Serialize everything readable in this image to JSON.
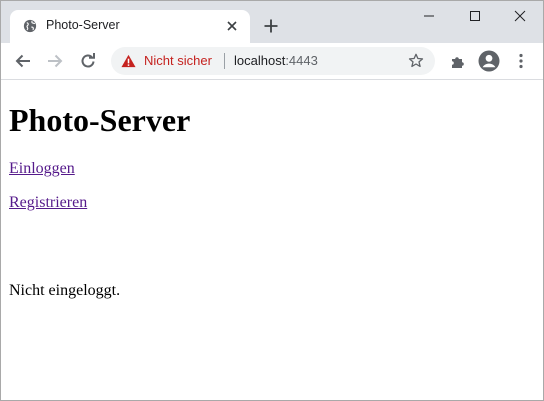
{
  "browser": {
    "tab": {
      "title": "Photo-Server",
      "favicon": "globe-icon"
    },
    "new_tab_icon": "plus-icon",
    "window_controls": [
      "minimize-icon",
      "maximize-icon",
      "close-icon"
    ],
    "toolbar": {
      "back_icon": "arrow-left-icon",
      "forward_icon": "arrow-right-icon",
      "reload_icon": "reload-icon",
      "security_label": "Nicht sicher",
      "url_host": "localhost",
      "url_port": ":4443",
      "bookmark_icon": "star-icon",
      "extensions_icon": "puzzle-icon",
      "profile_icon": "account-icon",
      "menu_icon": "kebab-menu-icon"
    },
    "colors": {
      "tabstrip": "#dee1e6",
      "omnibox": "#f1f3f4",
      "warning": "#c5221f",
      "link_visited": "#551a8b"
    }
  },
  "page": {
    "heading": "Photo-Server",
    "links": [
      "Einloggen",
      "Registrieren"
    ],
    "status": "Nicht eingeloggt."
  }
}
